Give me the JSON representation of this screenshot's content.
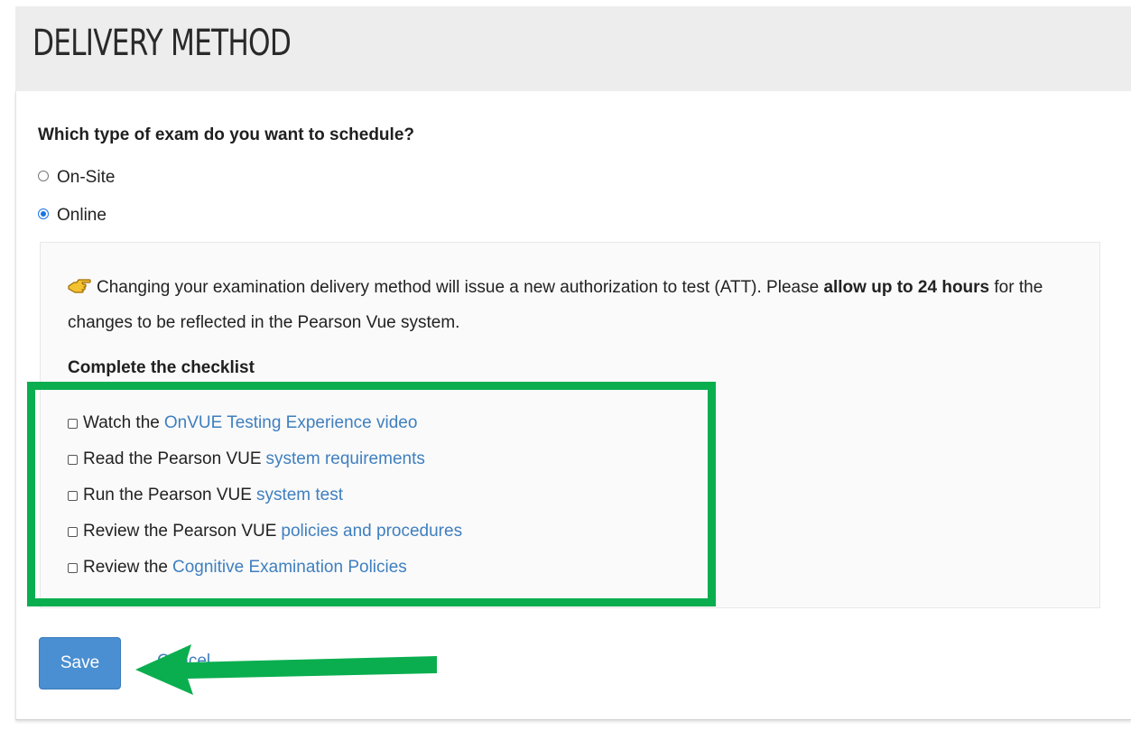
{
  "header": {
    "title": "DELIVERY METHOD"
  },
  "form": {
    "question": "Which type of exam do you want to schedule?",
    "options": [
      {
        "label": "On-Site",
        "selected": false
      },
      {
        "label": "Online",
        "selected": true
      }
    ]
  },
  "notice": {
    "text_before": "Changing your examination delivery method will issue a new authorization to test (ATT). Please ",
    "bold": "allow up to 24 hours",
    "text_after": " for the changes to be reflected in the Pearson Vue system."
  },
  "checklist": {
    "title": "Complete the checklist",
    "items": [
      {
        "prefix": "Watch the",
        "link": "OnVUE Testing Experience video"
      },
      {
        "prefix": "Read the Pearson VUE",
        "link": "system requirements"
      },
      {
        "prefix": "Run the Pearson VUE",
        "link": "system test"
      },
      {
        "prefix": "Review the Pearson VUE",
        "link": "policies and procedures"
      },
      {
        "prefix": "Review the",
        "link": "Cognitive Examination Policies"
      }
    ]
  },
  "actions": {
    "save_label": "Save",
    "cancel_label": "Cancel"
  },
  "colors": {
    "accent": "#4a8fd1",
    "link": "#3f7fbf",
    "highlight": "#0aae4f"
  },
  "icons": {
    "notice": "pointing-hand-icon",
    "annotation": "arrow-left-icon"
  }
}
